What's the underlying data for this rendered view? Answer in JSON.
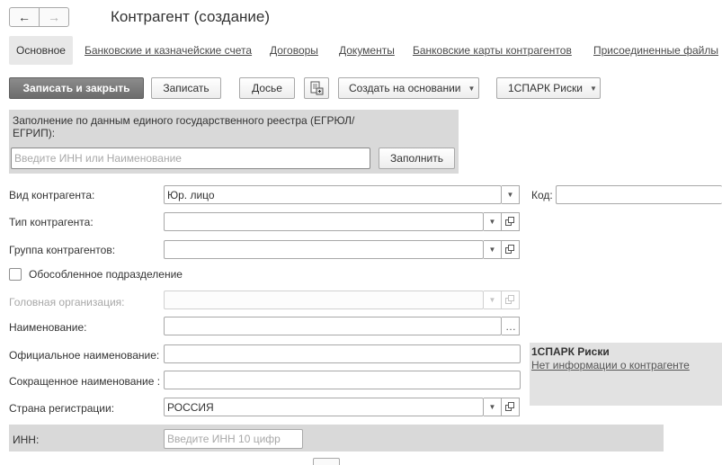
{
  "header": {
    "back_icon": "arrow-left-icon",
    "forward_icon": "arrow-right-icon",
    "title": "Контрагент (создание)"
  },
  "tabs": [
    {
      "label": "Основное"
    },
    {
      "label": "Банковские и казначейские счета"
    },
    {
      "label": "Договоры"
    },
    {
      "label": "Документы"
    },
    {
      "label": "Банковские карты контрагентов"
    },
    {
      "label": "Присоединенные файлы"
    }
  ],
  "toolbar": {
    "save_close": "Записать и закрыть",
    "save": "Записать",
    "dossier": "Досье",
    "attach_icon": "document-attach-icon",
    "create_based": "Создать на основании",
    "spark": "1СПАРК Риски"
  },
  "registry": {
    "caption": "Заполнение по данным единого государственного реестра (ЕГРЮЛ/ЕГРИП):",
    "placeholder": "Введите ИНН или Наименование",
    "fill_button": "Заполнить"
  },
  "form": {
    "kind_label": "Вид контрагента:",
    "kind_value": "Юр. лицо",
    "code_label": "Код:",
    "type_label": "Тип контрагента:",
    "group_label": "Группа контрагентов:",
    "separate_label": "Обособленное подразделение",
    "head_org_label": "Головная организация:",
    "name_label": "Наименование:",
    "official_label": "Официальное наименование:",
    "short_label": "Сокращенное наименование :",
    "country_label": "Страна регистрации:",
    "country_value": "РОССИЯ",
    "inn_label": "ИНН:",
    "inn_placeholder": "Введите ИНН 10 цифр"
  },
  "spark_panel": {
    "title": "1СПАРК Риски",
    "link": "Нет информации о контрагенте"
  },
  "colors": {
    "panel_bg": "#d9d9d9",
    "primary_button": "#7a7a7a",
    "active_tab": "#e8e8e8"
  }
}
